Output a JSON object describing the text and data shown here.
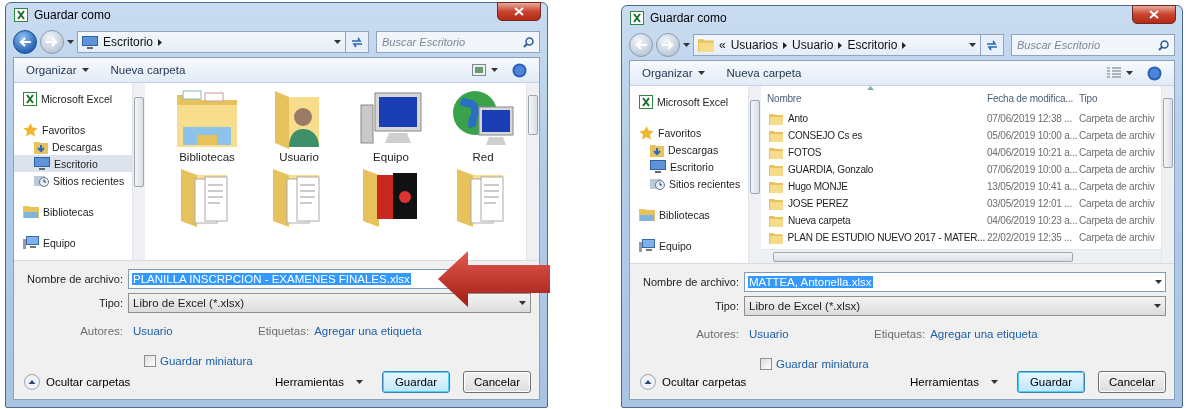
{
  "dialogs": [
    {
      "title": "Guardar como",
      "back_enabled": true,
      "address": {
        "kind": "desktop",
        "items": [
          "Escritorio"
        ]
      },
      "search": {
        "placeholder": "Buscar Escritorio"
      },
      "toolbar": {
        "organize": "Organizar",
        "new_folder": "Nueva carpeta"
      },
      "nav": [
        {
          "label": "Microsoft Excel",
          "kind": "excel",
          "selected": false
        },
        {
          "label": "Favoritos",
          "kind": "favorites",
          "selected": false,
          "children": [
            {
              "label": "Descargas",
              "kind": "downloads",
              "selected": false
            },
            {
              "label": "Escritorio",
              "kind": "desktop",
              "selected": true
            },
            {
              "label": "Sitios recientes",
              "kind": "recent",
              "selected": false
            }
          ]
        },
        {
          "label": "Bibliotecas",
          "kind": "libraries",
          "selected": false
        },
        {
          "label": "Equipo",
          "kind": "computer",
          "selected": false
        }
      ],
      "content": {
        "kind": "icons",
        "items": [
          {
            "kind": "libraries",
            "label": "Bibliotecas"
          },
          {
            "kind": "user",
            "label": "Usuario"
          },
          {
            "kind": "computer",
            "label": "Equipo"
          },
          {
            "kind": "network",
            "label": "Red"
          },
          {
            "kind": "docs"
          },
          {
            "kind": "docs"
          },
          {
            "kind": "magazines"
          },
          {
            "kind": "docs"
          }
        ]
      },
      "filename": {
        "label": "Nombre de archivo:",
        "value": "PLANILLA INSCRPCION - EXAMENES FINALES.xlsx",
        "value_selected": true
      },
      "type": {
        "label": "Tipo:",
        "value": "Libro de Excel (*.xlsx)"
      },
      "authors": {
        "label": "Autores:",
        "value": "Usuario"
      },
      "tags": {
        "label": "Etiquetas:",
        "value": "Agregar una etiqueta"
      },
      "thumbnail": {
        "label": "Guardar miniatura",
        "checked": false
      },
      "hide_folders": "Ocultar carpetas",
      "tools": "Herramientas",
      "save": "Guardar",
      "cancel": "Cancelar",
      "callout_arrow": true
    },
    {
      "title": "Guardar como",
      "back_enabled": false,
      "address": {
        "kind": "folder",
        "overflow": "«",
        "items": [
          "Usuarios",
          "Usuario",
          "Escritorio"
        ]
      },
      "search": {
        "placeholder": "Buscar Escritorio"
      },
      "toolbar": {
        "organize": "Organizar",
        "new_folder": "Nueva carpeta"
      },
      "nav": [
        {
          "label": "Microsoft Excel",
          "kind": "excel",
          "selected": false
        },
        {
          "label": "Favoritos",
          "kind": "favorites",
          "selected": false,
          "children": [
            {
              "label": "Descargas",
              "kind": "downloads",
              "selected": false
            },
            {
              "label": "Escritorio",
              "kind": "desktop",
              "selected": false
            },
            {
              "label": "Sitios recientes",
              "kind": "recent",
              "selected": false
            }
          ]
        },
        {
          "label": "Bibliotecas",
          "kind": "libraries",
          "selected": false
        },
        {
          "label": "Equipo",
          "kind": "computer",
          "selected": false
        }
      ],
      "content": {
        "kind": "details",
        "columns": [
          "Nombre",
          "Fecha de modifica...",
          "Tipo"
        ],
        "rows": [
          {
            "name": "Anto",
            "date": "07/06/2019 12:38 ...",
            "type": "Carpeta de archiv"
          },
          {
            "name": "CONSEJO Cs es",
            "date": "05/06/2019 10:00 a...",
            "type": "Carpeta de archiv"
          },
          {
            "name": "FOTOS",
            "date": "04/06/2019 10:21 a...",
            "type": "Carpeta de archiv"
          },
          {
            "name": "GUARDIA, Gonzalo",
            "date": "07/06/2019 10:00 a...",
            "type": "Carpeta de archiv"
          },
          {
            "name": "Hugo MONJE",
            "date": "13/05/2019 10:41 a...",
            "type": "Carpeta de archiv"
          },
          {
            "name": "JOSE PEREZ",
            "date": "03/05/2019 12:01 ...",
            "type": "Carpeta de archiv"
          },
          {
            "name": "Nueva carpeta",
            "date": "04/06/2019 10:23 a...",
            "type": "Carpeta de archiv"
          },
          {
            "name": "PLAN DE ESTUDIO NUEVO 2017 - MATER...",
            "date": "22/02/2019 12:35 ...",
            "type": "Carpeta de archiv"
          }
        ]
      },
      "filename": {
        "label": "Nombre de archivo:",
        "value": "MATTEA, Antonella.xlsx",
        "value_selected": true
      },
      "type": {
        "label": "Tipo:",
        "value": "Libro de Excel (*.xlsx)"
      },
      "authors": {
        "label": "Autores:",
        "value": "Usuario"
      },
      "tags": {
        "label": "Etiquetas:",
        "value": "Agregar una etiqueta"
      },
      "thumbnail": {
        "label": "Guardar miniatura",
        "checked": false
      },
      "hide_folders": "Ocultar carpetas",
      "tools": "Herramientas",
      "save": "Guardar",
      "cancel": "Cancelar",
      "callout_arrow": false
    }
  ]
}
